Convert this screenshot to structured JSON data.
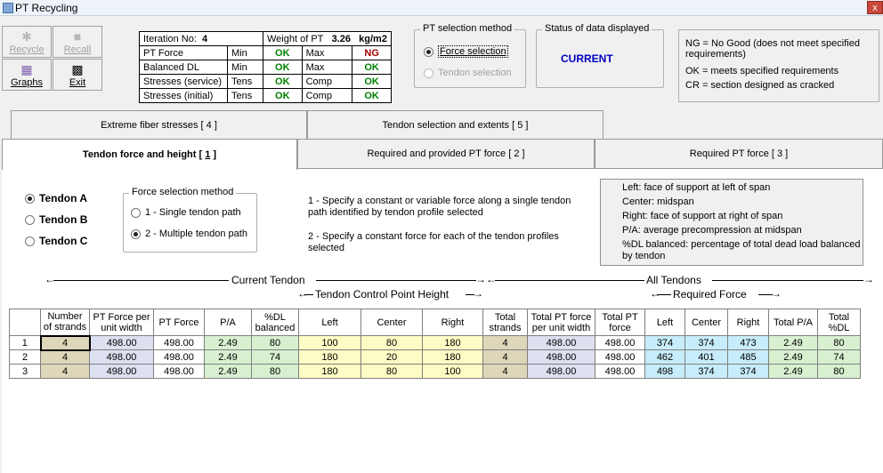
{
  "window": {
    "title": "PT Recycling",
    "close": "x"
  },
  "toolbar": {
    "recycle": "Recycle",
    "recall": "Recall",
    "graphs": "Graphs",
    "exit": "Exit"
  },
  "status_table": {
    "iteration_label": "Iteration No:",
    "iteration_value": "4",
    "weight_label": "Weight of PT",
    "weight_value": "3.26",
    "weight_unit": "kg/m2",
    "rows": [
      {
        "label": "PT Force",
        "c1": "Min",
        "v1": "OK",
        "c2": "Max",
        "v2": "NG"
      },
      {
        "label": "Balanced DL",
        "c1": "Min",
        "v1": "OK",
        "c2": "Max",
        "v2": "OK"
      },
      {
        "label": "Stresses (service)",
        "c1": "Tens",
        "v1": "OK",
        "c2": "Comp",
        "v2": "OK"
      },
      {
        "label": "Stresses (initial)",
        "c1": "Tens",
        "v1": "OK",
        "c2": "Comp",
        "v2": "OK"
      }
    ]
  },
  "pt_selection": {
    "title": "PT selection method",
    "option1": "Force selection",
    "option2": "Tendon selection",
    "selected": "Force selection"
  },
  "status_data": {
    "title": "Status of data displayed",
    "value": "CURRENT"
  },
  "legend": {
    "ng": "NG = No Good (does not meet specified requirements)",
    "ok": "OK = meets specified requirements",
    "cr": "CR = section designed as cracked"
  },
  "tabs": {
    "t4": "Extreme fiber stresses [ 4 ]",
    "t5": "Tendon selection and extents [ 5 ]",
    "t1_text": "Tendon force and height [ ",
    "t1_num": "1",
    "t1_end": " ]",
    "t2": "Required and provided PT force [ 2 ]",
    "t3": "Required PT force [ 3 ]"
  },
  "tendons": {
    "a": "Tendon A",
    "b": "Tendon B",
    "c": "Tendon C",
    "selected": "Tendon A"
  },
  "force_method": {
    "title": "Force selection method",
    "opt1": "1 - Single tendon path",
    "opt2": "2 - Multiple tendon path",
    "selected": "2 - Multiple tendon path"
  },
  "descriptions": {
    "d1": "1 - Specify a constant or variable force along a single tendon path identified by tendon profile selected",
    "d2": "2 - Specify a constant force for each of the tendon profiles selected"
  },
  "info_box": {
    "left": "Left: face of support at left of span",
    "center": "Center: midspan",
    "right": "Right: face of support at right of span",
    "pa": "P/A: average precompression at midspan",
    "dl": "%DL balanced: percentage of total dead load balanced by tendon"
  },
  "headers": {
    "current_tendon": "Current Tendon",
    "control_point": "Tendon Control Point Height",
    "all_tendons": "All Tendons",
    "required_force": "Required Force"
  },
  "grid": {
    "columns": [
      "Number of strands",
      "PT Force per unit width",
      "PT Force",
      "P/A",
      "%DL balanced",
      "Left",
      "Center",
      "Right",
      "Total strands",
      "Total PT force per unit width",
      "Total PT force",
      "Left",
      "Center",
      "Right",
      "Total P/A",
      "Total %DL"
    ],
    "rows": [
      {
        "id": "1",
        "cells": [
          "4",
          "498.00",
          "498.00",
          "2.49",
          "80",
          "100",
          "80",
          "180",
          "4",
          "498.00",
          "498.00",
          "374",
          "374",
          "473",
          "2.49",
          "80"
        ]
      },
      {
        "id": "2",
        "cells": [
          "4",
          "498.00",
          "498.00",
          "2.49",
          "74",
          "180",
          "20",
          "180",
          "4",
          "498.00",
          "498.00",
          "462",
          "401",
          "485",
          "2.49",
          "74"
        ]
      },
      {
        "id": "3",
        "cells": [
          "4",
          "498.00",
          "498.00",
          "2.49",
          "80",
          "180",
          "80",
          "100",
          "4",
          "498.00",
          "498.00",
          "498",
          "374",
          "374",
          "2.49",
          "80"
        ]
      }
    ]
  }
}
